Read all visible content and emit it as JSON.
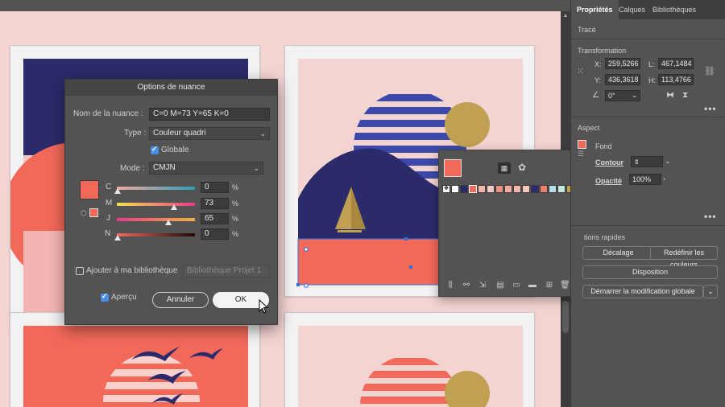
{
  "colors": {
    "navy": "#2b2b6b",
    "coral": "#f2695a",
    "blush": "#f4d4d2",
    "sun_gold": "#c0a052",
    "stripe_blue": "#3b4aa8",
    "panel_bg": "#535353",
    "accent_blue": "#4b8ce8"
  },
  "dialog": {
    "title": "Options de nuance",
    "name_label": "Nom de la nuance :",
    "name_value": "C=0 M=73 Y=65 K=0",
    "type_label": "Type :",
    "type_value": "Couleur quadri",
    "global_label": "Globale",
    "global_checked": true,
    "mode_label": "Mode :",
    "mode_value": "CMJN",
    "channels": [
      {
        "label": "C",
        "value": "0",
        "level": 0,
        "unit": "%"
      },
      {
        "label": "M",
        "value": "73",
        "level": 73,
        "unit": "%"
      },
      {
        "label": "J",
        "value": "65",
        "level": 65,
        "unit": "%"
      },
      {
        "label": "N",
        "value": "0",
        "level": 0,
        "unit": "%"
      }
    ],
    "add_library_label": "Ajouter à ma bibliothèque",
    "library_value": "Bibliothèque Projet 1",
    "preview_label": "Aperçu",
    "cancel_label": "Annuler",
    "ok_label": "OK"
  },
  "properties": {
    "tabs": [
      "Propriétés",
      "Calques",
      "Bibliothèques"
    ],
    "section_trace": "Tracé",
    "section_transform": "Transformation",
    "x_label": "X:",
    "x_value": "259,5266",
    "y_label": "Y:",
    "y_value": "436,3618",
    "w_label": "L:",
    "w_value": "467,1484",
    "h_label": "H:",
    "h_value": "113,4766",
    "angle_value": "0°",
    "section_appearance": "Aspect",
    "fill_label": "Fond",
    "stroke_label": "Contour",
    "opacity_label": "Opacité",
    "opacity_value": "100%",
    "quick_actions": "tions rapides",
    "offset_button": "Décalage",
    "recolor_button": "Redéfinir les couleurs",
    "arrange_button": "Disposition",
    "global_edit_button": "Démarrer la modification globale"
  },
  "swatch_panel": {
    "swatches": [
      "#ffffff",
      "#111111",
      "#2b2b6b",
      "#f2695a",
      "#f8b3ae",
      "#f3c9c5",
      "#e98f86",
      "#f6a9a3",
      "#2b2b6b",
      "#f9c8c2",
      "#ef7e73",
      "#b9e0ea",
      "#c7e6df",
      "#d8e4b8",
      "#c0a052"
    ]
  }
}
